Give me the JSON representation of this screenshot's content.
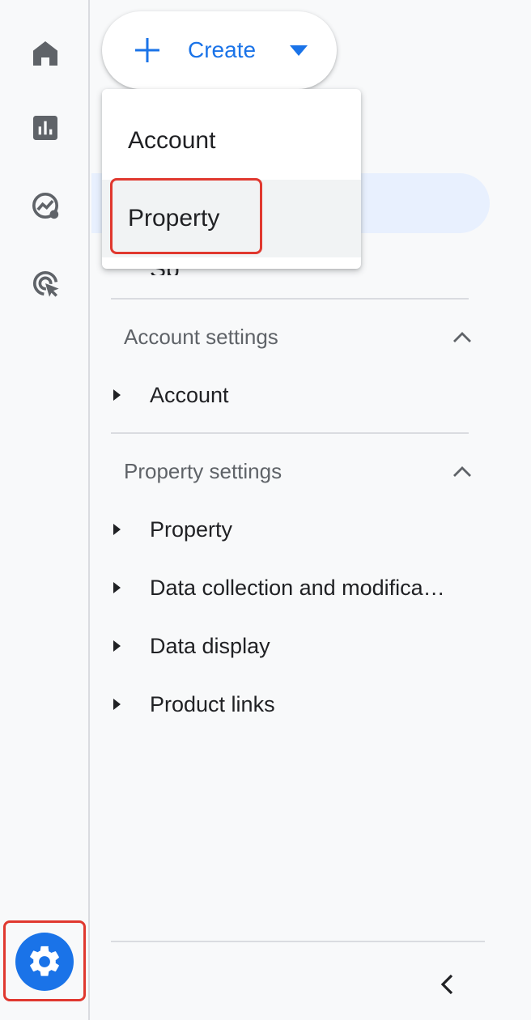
{
  "rail": {
    "items": [
      {
        "icon": "home-icon"
      },
      {
        "icon": "reports-icon"
      },
      {
        "icon": "explore-icon"
      },
      {
        "icon": "advertising-icon"
      }
    ],
    "settings_icon": "gear-icon"
  },
  "create": {
    "label": "Create",
    "menu": [
      {
        "label": "Account"
      },
      {
        "label": "Property"
      }
    ]
  },
  "hidden_text": "Sp",
  "account_settings": {
    "title": "Account settings",
    "items": [
      {
        "label": "Account"
      }
    ]
  },
  "property_settings": {
    "title": "Property settings",
    "items": [
      {
        "label": "Property"
      },
      {
        "label": "Data collection and modifica…"
      },
      {
        "label": "Data display"
      },
      {
        "label": "Product links"
      }
    ]
  },
  "colors": {
    "accent": "#1a73e8",
    "highlight": "#e0382f",
    "selected_band": "#e8f0fe"
  }
}
